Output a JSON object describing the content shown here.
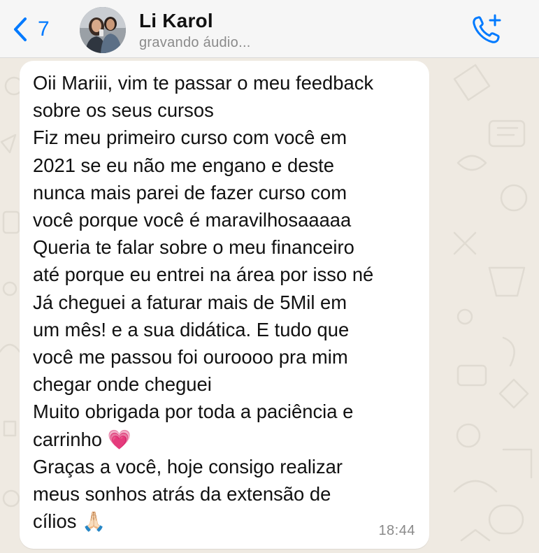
{
  "header": {
    "back_count": "7",
    "contact_name": "Li Karol",
    "contact_status": "gravando áudio..."
  },
  "message": {
    "lines": [
      "Oii Mariii, vim te passar o meu feedback",
      "sobre os seus cursos",
      "Fiz meu primeiro curso com você em",
      "2021 se eu não me engano e deste",
      "nunca mais parei de fazer curso com",
      "você porque você é maravilhosaaaaa",
      "Queria te falar sobre o meu financeiro",
      "até porque eu entrei na área por isso né",
      "Já cheguei a faturar mais de 5Mil em",
      "um mês! e a sua didática. E tudo que",
      "você me passou foi ouroooo pra mim",
      "chegar onde cheguei",
      "Muito obrigada por toda a paciência e",
      "carrinho 💗",
      "Graças a você, hoje consigo realizar",
      "meus sonhos atrás da extensão de",
      "cílios 🙏🏻"
    ],
    "time": "18:44"
  },
  "colors": {
    "accent": "#007aff",
    "chat_background": "#efeae2",
    "bubble": "#ffffff",
    "header": "#f6f6f6"
  },
  "icons": {
    "back": "chevron-left-icon",
    "call": "phone-plus-icon"
  }
}
